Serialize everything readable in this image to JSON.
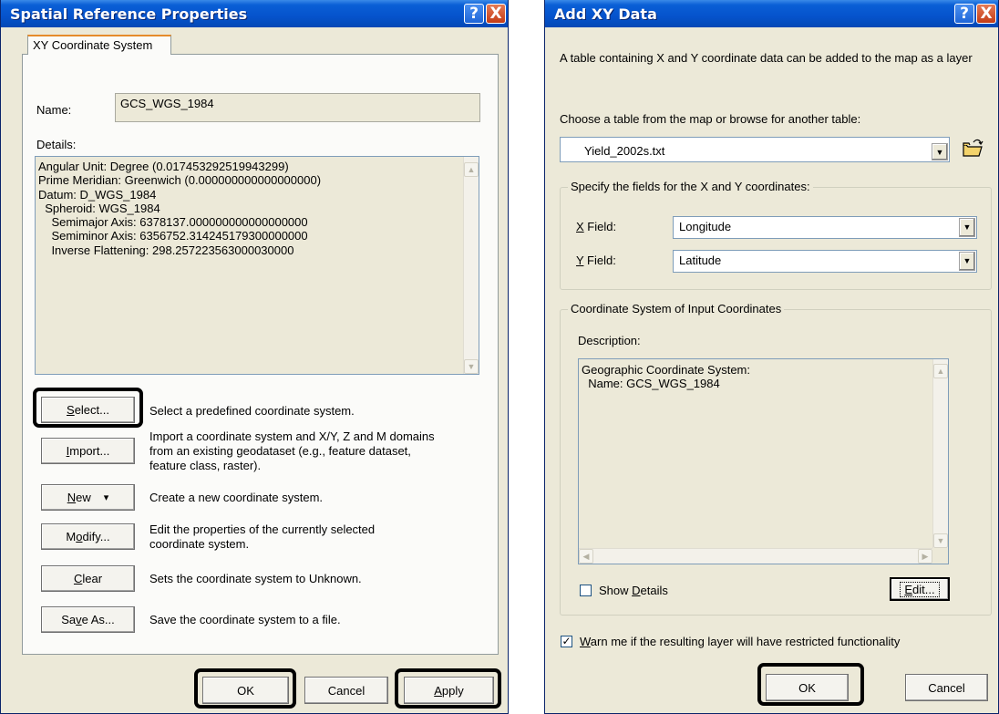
{
  "spatial": {
    "title": "Spatial Reference Properties",
    "help_icon": "?",
    "close_icon": "X",
    "tab": "XY Coordinate System",
    "name_label": "Name:",
    "name_value": "GCS_WGS_1984",
    "details_label": "Details:",
    "details": [
      "Angular Unit: Degree (0.017453292519943299)",
      "Prime Meridian: Greenwich (0.000000000000000000)",
      "Datum: D_WGS_1984",
      "  Spheroid: WGS_1984",
      "    Semimajor Axis: 6378137.000000000000000000",
      "    Semiminor Axis: 6356752.314245179300000000",
      "    Inverse Flattening: 298.257223563000030000"
    ],
    "actions": [
      {
        "pre": "",
        "u": "S",
        "post": "elect...",
        "desc": "Select a predefined coordinate system."
      },
      {
        "pre": "",
        "u": "I",
        "post": "mport...",
        "desc": "Import a coordinate system and X/Y, Z and M domains from an existing geodataset (e.g., feature dataset, feature class, raster)."
      },
      {
        "pre": "",
        "u": "N",
        "post": "ew",
        "desc": "Create a new coordinate system."
      },
      {
        "pre": "M",
        "u": "o",
        "post": "dify...",
        "desc": "Edit the properties of the currently selected coordinate system."
      },
      {
        "pre": "",
        "u": "C",
        "post": "lear",
        "desc": "Sets the coordinate system to Unknown."
      },
      {
        "pre": "Sa",
        "u": "v",
        "post": "e As...",
        "desc": "Save the coordinate system to a file."
      }
    ],
    "new_arrow": "▾",
    "ok_label": "OK",
    "cancel_label": "Cancel",
    "apply_pre": "",
    "apply_u": "A",
    "apply_post": "pply"
  },
  "addxy": {
    "title": "Add XY Data",
    "help_icon": "?",
    "close_icon": "X",
    "intro": "A table containing X and Y coordinate data can be added to the map as a layer",
    "choose_label": "Choose a table from the map or browse for another table:",
    "table_value": "Yield_2002s.txt",
    "fields_group": "Specify the fields for the X and Y coordinates:",
    "x_u": "X",
    "x_rest": " Field:",
    "x_value": "Longitude",
    "y_u": "Y",
    "y_rest": " Field:",
    "y_value": "Latitude",
    "cs_group": "Coordinate System of Input Coordinates",
    "description_label": "Description:",
    "description": [
      "Geographic Coordinate System:",
      "  Name: GCS_WGS_1984"
    ],
    "show_pre": "Show ",
    "show_u": "D",
    "show_post": "etails",
    "edit_pre": "",
    "edit_u": "E",
    "edit_post": "dit...",
    "warn_u": "W",
    "warn_rest": "arn me if the resulting layer will have restricted functionality",
    "warn_check": "✓",
    "ok_label": "OK",
    "cancel_label": "Cancel"
  }
}
